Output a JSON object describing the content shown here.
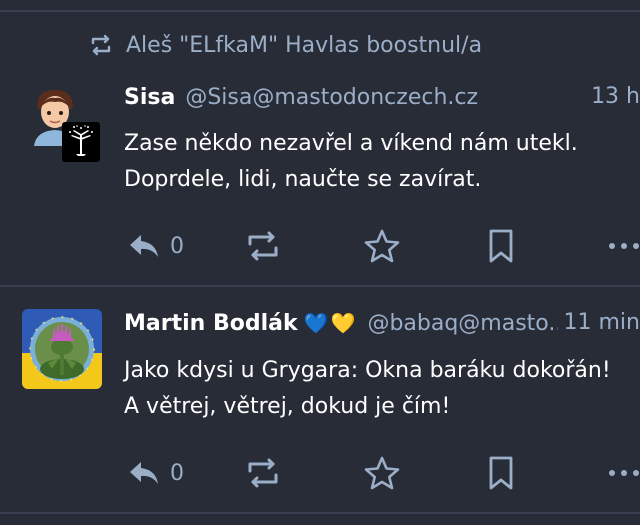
{
  "boost": {
    "icon": "retweet-icon",
    "text": "Aleš  \"ELfkaM\" Havlas boostnul/a"
  },
  "posts": [
    {
      "display_name": "Sisa",
      "acct": "@Sisa@mastodonczech.cz",
      "time": "13 h",
      "content": [
        "Zase někdo nezavřel a víkend nám utekl.",
        "Doprdele, lidi, naučte se zavírat."
      ],
      "reply_count": "0"
    },
    {
      "display_name": "Martin Bodlák",
      "emoji": "💙💛",
      "acct": "@babaq@masto...",
      "time": "11 min",
      "content": [
        "Jako kdysi u Grygara: Okna baráku dokořán!",
        "A větrej, větrej, dokud je čím!"
      ],
      "reply_count": "0"
    }
  ],
  "colors": {
    "background": "#282c37",
    "secondary_text": "#9baec8",
    "divider": "#393f4f"
  }
}
